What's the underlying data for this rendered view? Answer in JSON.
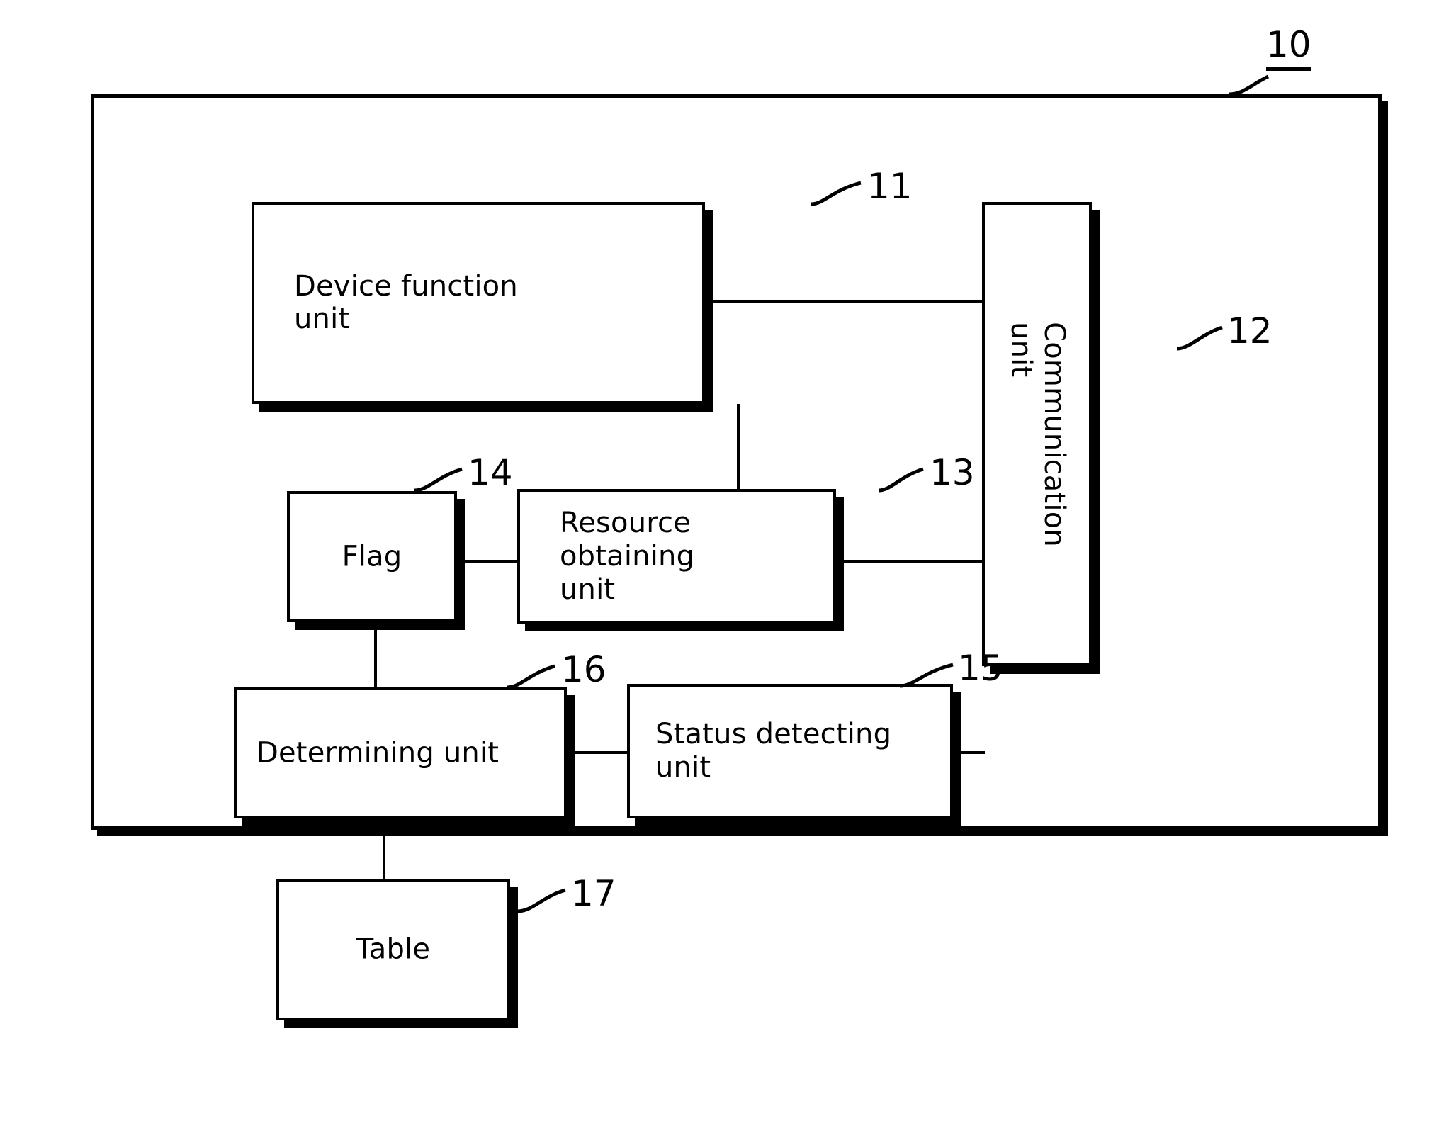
{
  "figure": {
    "type": "patent-block-diagram",
    "system_numeral": "10"
  },
  "blocks": [
    {
      "id": "device-function",
      "label": "Device function\nunit",
      "numeral": "11"
    },
    {
      "id": "communication",
      "label": "Communication unit",
      "numeral": "12"
    },
    {
      "id": "resource",
      "label": "Resource obtaining\nunit",
      "numeral": "13"
    },
    {
      "id": "flag",
      "label": "Flag",
      "numeral": "14"
    },
    {
      "id": "status",
      "label": "Status detecting\nunit",
      "numeral": "15"
    },
    {
      "id": "determining",
      "label": "Determining unit",
      "numeral": "16"
    },
    {
      "id": "table",
      "label": "Table",
      "numeral": "17"
    }
  ],
  "labels": {
    "system": "10",
    "device_function": "Device function\nunit",
    "device_function_ref": "11",
    "communication": "Communication unit",
    "communication_ref": "12",
    "resource": "Resource obtaining\nunit",
    "resource_ref": "13",
    "flag": "Flag",
    "flag_ref": "14",
    "status": "Status detecting\nunit",
    "status_ref": "15",
    "determining": "Determining unit",
    "determining_ref": "16",
    "table": "Table",
    "table_ref": "17"
  },
  "connections": [
    {
      "from": "device-function",
      "to": "communication"
    },
    {
      "from": "device-function",
      "to": "resource"
    },
    {
      "from": "flag",
      "to": "resource"
    },
    {
      "from": "resource",
      "to": "communication"
    },
    {
      "from": "flag",
      "to": "determining"
    },
    {
      "from": "determining",
      "to": "status"
    },
    {
      "from": "status",
      "to": "communication"
    },
    {
      "from": "determining",
      "to": "table"
    }
  ],
  "colors": {
    "ink": "#000000",
    "paper": "#ffffff"
  }
}
